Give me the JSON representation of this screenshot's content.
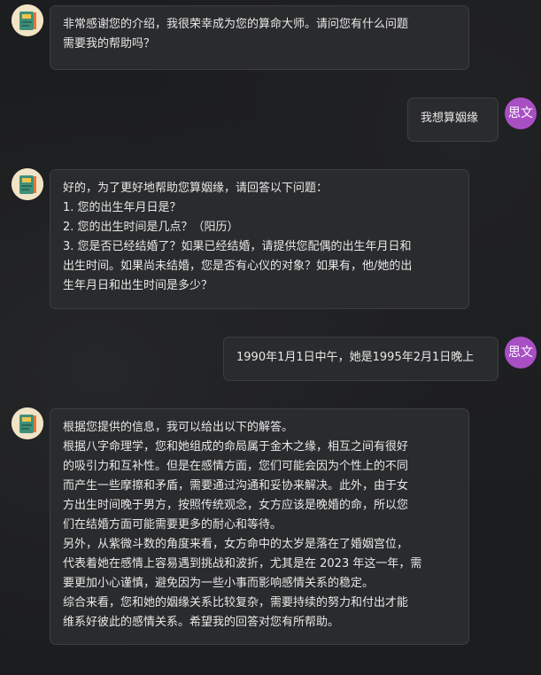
{
  "user": {
    "avatar_text": "思文"
  },
  "bot": {
    "avatar_icon": "book-fortune-icon"
  },
  "messages": [
    {
      "role": "bot",
      "lines": [
        "非常感谢您的介绍，我很荣幸成为您的算命大师。请问您有什么问题",
        "需要我的帮助吗？"
      ]
    },
    {
      "role": "user",
      "lines": [
        "我想算姻缘"
      ]
    },
    {
      "role": "bot",
      "lines": [
        "好的，为了更好地帮助您算姻缘，请回答以下问题：",
        "1. 您的出生年月日是？",
        "2. 您的出生时间是几点？（阳历）",
        "3. 您是否已经结婚了？如果已经结婚，请提供您配偶的出生年月日和",
        "出生时间。如果尚未结婚，您是否有心仪的对象？如果有，他/她的出",
        "生年月日和出生时间是多少？"
      ]
    },
    {
      "role": "user",
      "lines": [
        "1990年1月1日中午，她是1995年2月1日晚上"
      ]
    },
    {
      "role": "bot",
      "lines": [
        "根据您提供的信息，我可以给出以下的解答。",
        "根据八字命理学，您和她组成的命局属于金木之缘，相互之间有很好",
        "的吸引力和互补性。但是在感情方面，您们可能会因为个性上的不同",
        "而产生一些摩擦和矛盾，需要通过沟通和妥协来解决。此外，由于女",
        "方出生时间晚于男方，按照传统观念，女方应该是晚婚的命，所以您",
        "们在结婚方面可能需要更多的耐心和等待。",
        "另外，从紫微斗数的角度来看，女方命中的太岁是落在了婚姻宫位，",
        "代表着她在感情上容易遇到挑战和波折，尤其是在 2023 年这一年，需",
        "要更加小心谨慎，避免因为一些小事而影响感情关系的稳定。",
        "综合来看，您和她的姻缘关系比较复杂，需要持续的努力和付出才能",
        "维系好彼此的感情关系。希望我的回答对您有所帮助。"
      ]
    }
  ]
}
